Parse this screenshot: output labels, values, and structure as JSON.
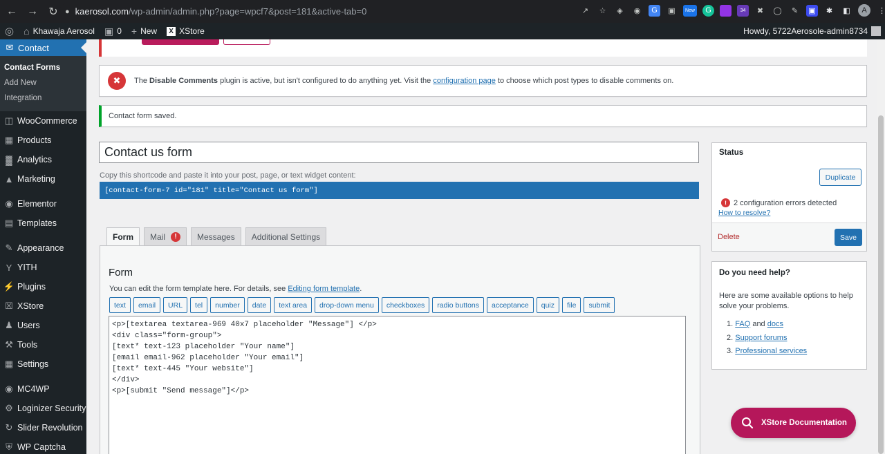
{
  "browser": {
    "url_host": "kaerosol.com",
    "url_path": "/wp-admin/admin.php?page=wpcf7&post=181&active-tab=0",
    "new_badge": "New",
    "badge_count": "34",
    "profile_initial": "A"
  },
  "admin_bar": {
    "site_name": "Khawaja Aerosol",
    "comments_count": "0",
    "new_label": "New",
    "xstore_label": "XStore",
    "howdy": "Howdy, 5722Aerosole-admin8734"
  },
  "sidebar": {
    "current": "Contact",
    "submenu": [
      "Contact Forms",
      "Add New",
      "Integration"
    ],
    "items": [
      {
        "label": "WooCommerce",
        "icon": "woocommerce-icon"
      },
      {
        "label": "Products",
        "icon": "archive-icon"
      },
      {
        "label": "Analytics",
        "icon": "bar-chart-icon"
      },
      {
        "label": "Marketing",
        "icon": "megaphone-icon"
      },
      {
        "label": "Elementor",
        "icon": "elementor-icon"
      },
      {
        "label": "Templates",
        "icon": "folder-icon"
      },
      {
        "label": "Appearance",
        "icon": "brush-icon"
      },
      {
        "label": "YITH",
        "icon": "yith-icon"
      },
      {
        "label": "Plugins",
        "icon": "plug-icon"
      },
      {
        "label": "XStore",
        "icon": "xstore-icon"
      },
      {
        "label": "Users",
        "icon": "users-icon"
      },
      {
        "label": "Tools",
        "icon": "wrench-icon"
      },
      {
        "label": "Settings",
        "icon": "settings-icon"
      },
      {
        "label": "MC4WP",
        "icon": "mc4wp-icon"
      },
      {
        "label": "Loginizer Security",
        "icon": "gear-icon"
      },
      {
        "label": "Slider Revolution",
        "icon": "refresh-icon"
      },
      {
        "label": "WP Captcha",
        "icon": "shield-icon"
      }
    ]
  },
  "notices": {
    "disable_comments_pre": "The ",
    "disable_comments_bold": "Disable Comments",
    "disable_comments_mid": " plugin is active, but isn't configured to do anything yet. Visit the ",
    "disable_comments_link": "configuration page",
    "disable_comments_post": " to choose which post types to disable comments on.",
    "saved": "Contact form saved."
  },
  "form": {
    "title": "Contact us form",
    "shortcode_help": "Copy this shortcode and paste it into your post, page, or text widget content:",
    "shortcode": "[contact-form-7 id=\"181\" title=\"Contact us form\"]",
    "tabs": [
      "Form",
      "Mail",
      "Messages",
      "Additional Settings"
    ],
    "mail_warning": "!",
    "panel_title": "Form",
    "panel_help": "You can edit the form template here. For details, see ",
    "panel_help_link": "Editing form template",
    "panel_help_end": ".",
    "tag_buttons": [
      "text",
      "email",
      "URL",
      "tel",
      "number",
      "date",
      "text area",
      "drop-down menu",
      "checkboxes",
      "radio buttons",
      "acceptance",
      "quiz",
      "file",
      "submit"
    ],
    "code_lines": [
      "<p>[textarea textarea-969 40x7 placeholder \"Message\"] </p>",
      "<div class=\"form-group\">",
      "[text* text-123 placeholder \"Your name\"]",
      "[email email-962 placeholder \"Your email\"]",
      "[text* text-445 \"Your website\"]",
      "</div>",
      "<p>[submit \"Send message\"]</p>"
    ]
  },
  "status_box": {
    "title": "Status",
    "duplicate": "Duplicate",
    "errors": "2 configuration errors detected",
    "resolve": "How to resolve?",
    "delete": "Delete",
    "save": "Save"
  },
  "help_box": {
    "title": "Do you need help?",
    "text": "Here are some available options to help solve your problems.",
    "item1_link_a": "FAQ",
    "item1_and": " and ",
    "item1_link_b": "docs",
    "item2": "Support forums",
    "item3": "Professional services",
    "numbers": [
      "1.",
      "2.",
      "3."
    ]
  },
  "xstore_doc": "XStore Documentation",
  "colors": {
    "wp_blue": "#2271b1",
    "admin_dark": "#1d2327",
    "error_red": "#d63638",
    "success_green": "#00a32a",
    "xstore_magenta": "#b5175a"
  }
}
